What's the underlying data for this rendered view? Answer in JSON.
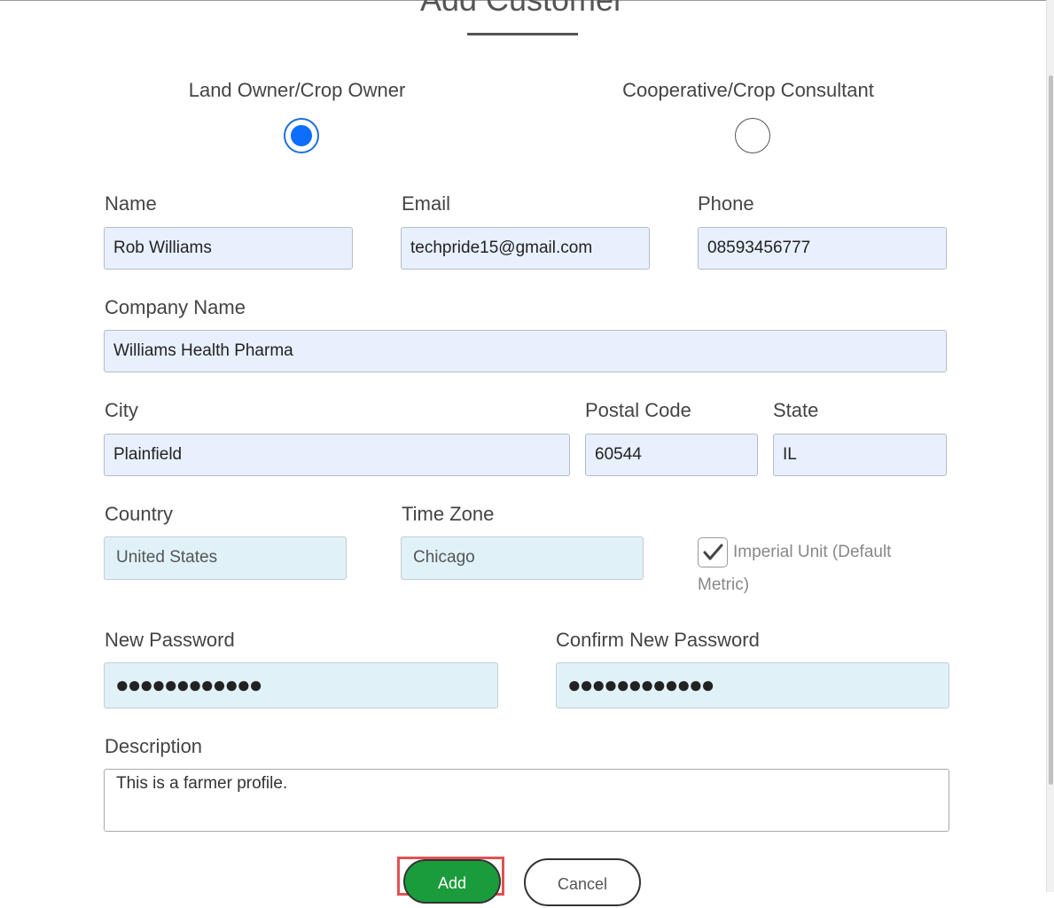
{
  "title": "Add Customer",
  "customer_type": {
    "options": [
      {
        "label": "Land Owner/Crop Owner",
        "checked": true
      },
      {
        "label": "Cooperative/Crop Consultant",
        "checked": false
      }
    ]
  },
  "fields": {
    "name": {
      "label": "Name",
      "value": "Rob Williams"
    },
    "email": {
      "label": "Email",
      "value": "techpride15@gmail.com"
    },
    "phone": {
      "label": "Phone",
      "value": "08593456777"
    },
    "company": {
      "label": "Company Name",
      "value": "Williams Health Pharma"
    },
    "city": {
      "label": "City",
      "value": "Plainfield"
    },
    "postal": {
      "label": "Postal Code",
      "value": "60544"
    },
    "state": {
      "label": "State",
      "value": "IL"
    },
    "country": {
      "label": "Country",
      "value": "United States"
    },
    "timezone": {
      "label": "Time Zone",
      "value": "Chicago"
    },
    "imperial": {
      "label": "Imperial Unit (Default Metric)",
      "checked": true
    },
    "new_password": {
      "label": "New Password",
      "value": "●●●●●●●●●●●●"
    },
    "confirm_password": {
      "label": "Confirm New Password",
      "value": "●●●●●●●●●●●●"
    },
    "description": {
      "label": "Description",
      "value": "This is a farmer profile."
    }
  },
  "buttons": {
    "add": "Add",
    "cancel": "Cancel"
  },
  "colors": {
    "accent_radio": "#0d6efd",
    "add_button": "#1b9c3c",
    "highlight": "#e05252",
    "input_bg": "#e8f0fe"
  }
}
